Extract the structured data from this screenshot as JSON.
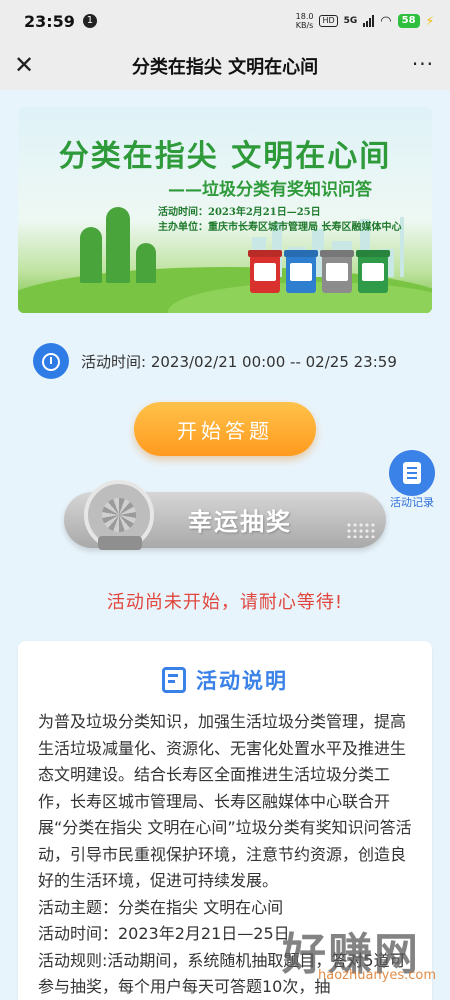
{
  "status_bar": {
    "time": "23:59",
    "notification_badge": "1",
    "net_speed_value": "18.0",
    "net_speed_unit": "KB/s",
    "hd_label": "HD",
    "network": "5G",
    "battery": "58",
    "battery_color": "#2fbf3f"
  },
  "title_bar": {
    "close_icon": "close-icon",
    "title": "分类在指尖 文明在心间",
    "more_icon": "more-icon"
  },
  "banner": {
    "title": "分类在指尖  文明在心间",
    "subtitle": "——垃圾分类有奖知识问答",
    "time_line": "活动时间：2023年2月21日—25日",
    "host_line": "主办单位：重庆市长寿区城市管理局 长寿区融媒体中心",
    "bin_colors": [
      "#d9322e",
      "#2f7fd0",
      "#8c8c8c",
      "#2f9a48"
    ]
  },
  "activity_time": {
    "icon": "clock-icon",
    "text": "活动时间: 2023/02/21 00:00 -- 02/25 23:59"
  },
  "start_button": {
    "label": "开始答题"
  },
  "records_button": {
    "icon": "document-icon",
    "label": "活动记录"
  },
  "lucky_draw": {
    "label": "幸运抽奖",
    "icon": "prize-wheel-icon"
  },
  "status_message": "活动尚未开始，请耐心等待!",
  "description": {
    "icon": "document-icon",
    "title": "活动说明",
    "paragraphs": [
      "为普及垃圾分类知识，加强生活垃圾分类管理，提高生活垃圾减量化、资源化、无害化处置水平及推进生态文明建设。结合长寿区全面推进生活垃圾分类工作，长寿区城市管理局、长寿区融媒体中心联合开展“分类在指尖 文明在心间”垃圾分类有奖知识问答活动，引导市民重视保护环境，注意节约资源，创造良好的生活环境，促进可持续发展。",
      "活动主题：分类在指尖 文明在心间",
      "活动时间：2023年2月21日—25日",
      "活动规则:活动期间，系统随机抽取题目，答对5道可参与抽奖，每个用户每天可答题10次，抽"
    ]
  },
  "watermark": {
    "main": "好赚网",
    "small": "haozhuanyes.com"
  }
}
